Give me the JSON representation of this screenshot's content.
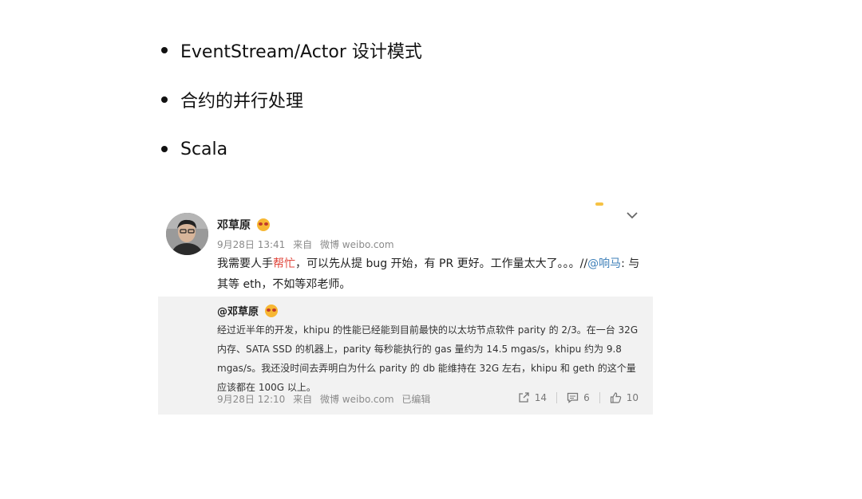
{
  "bullets": [
    {
      "text": "EventStream/Actor 设计模式"
    },
    {
      "text": "合约的并行处理"
    },
    {
      "text": "Scala"
    }
  ],
  "post": {
    "author": "邓草原",
    "meta": {
      "date": "9月28日 13:41",
      "source_prefix": "来自",
      "source": "微博 weibo.com"
    },
    "text_part1": "我需要人手",
    "text_highlight": "帮忙",
    "text_part2": "，可以先从提 bug 开始，有 PR 更好。工作量太大了。。。//",
    "mention": "@响马",
    "text_part3": ": 与其等 eth，不如等邓老师。",
    "highlight_color": "#e0453b",
    "link_color": "#3d7fb8"
  },
  "repost": {
    "author": "@邓草原",
    "text": "经过近半年的开发，khipu 的性能已经能到目前最快的以太坊节点软件 parity 的 2/3。在一台 32G 内存、SATA SSD 的机器上，parity 每秒能执行的 gas 量约为 14.5 mgas/s，khipu 约为 9.8 mgas/s。我还没时间去弄明白为什么 parity 的 db 能维持在 32G 左右，khipu 和 geth 的这个量应该都在 100G 以上。",
    "meta": {
      "date": "9月28日 12:10",
      "source_prefix": "来自",
      "source": "微博 weibo.com",
      "edited": "已编辑"
    },
    "actions": {
      "share_count": "14",
      "comment_count": "6",
      "like_count": "10"
    }
  },
  "icons": [
    "chevron-down-icon",
    "share-icon",
    "comment-icon",
    "like-icon",
    "emoji-icon"
  ]
}
